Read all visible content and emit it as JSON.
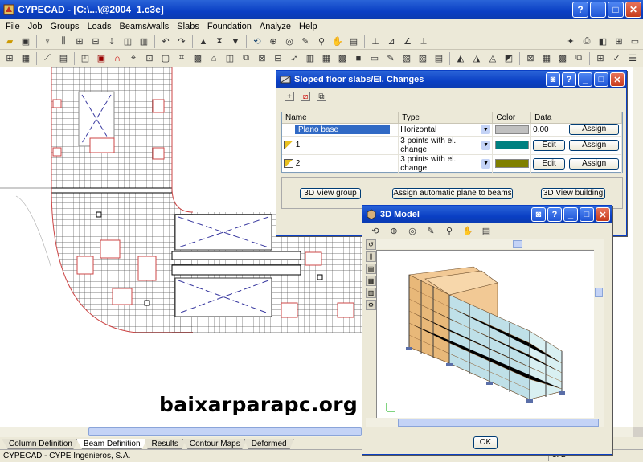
{
  "app": {
    "title": "CYPECAD - [C:\\...\\@2004_1.c3e]",
    "menus": [
      "File",
      "Job",
      "Groups",
      "Loads",
      "Beams/walls",
      "Slabs",
      "Foundation",
      "Analyze",
      "Help"
    ]
  },
  "tabs": [
    "Column Definition",
    "Beam Definition",
    "Results",
    "Contour Maps",
    "Deformed"
  ],
  "active_tab": "Beam Definition",
  "status": {
    "left": "CYPECAD - CYPE Ingenieros, S.A.",
    "right": "3. 2"
  },
  "watermark": "baixarparapc.org",
  "slabs_dialog": {
    "title": "Sloped floor slabs/El. Changes",
    "columns": [
      "Name",
      "Type",
      "Color",
      "Data"
    ],
    "rows": [
      {
        "name": "Plano base",
        "type": "Horizontal",
        "color": "#c0c0c0",
        "data": "0.00",
        "action": "Assign",
        "selected": true
      },
      {
        "name": "1",
        "type": "3 points with el. change",
        "color": "#008080",
        "data": "Edit",
        "action": "Assign",
        "selected": false
      },
      {
        "name": "2",
        "type": "3 points with el. change",
        "color": "#808000",
        "data": "Edit",
        "action": "Assign",
        "selected": false
      }
    ],
    "buttons": {
      "view_group": "3D View group",
      "assign_auto": "Assign automatic plane to beams",
      "view_building": "3D View building"
    }
  },
  "model_dialog": {
    "title": "3D Model",
    "ok_label": "OK"
  }
}
